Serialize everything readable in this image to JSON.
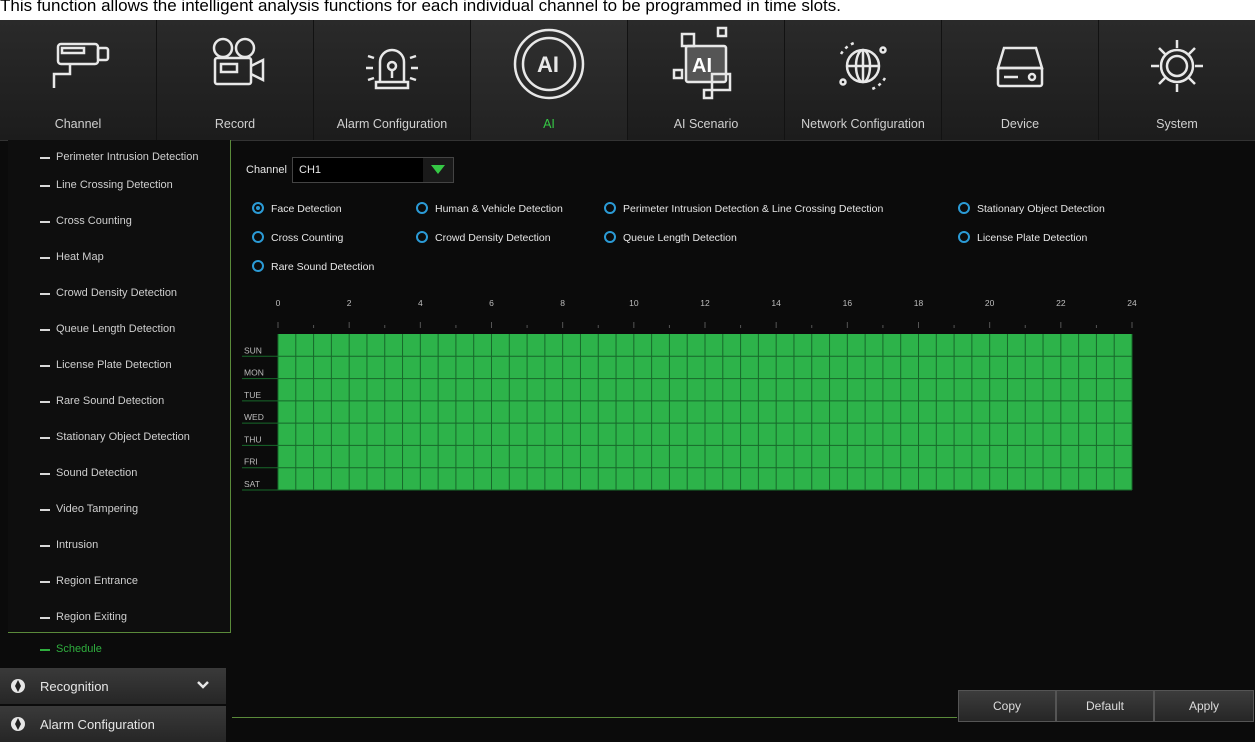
{
  "caption": "This function allows the intelligent analysis functions for each individual channel to be programmed in time slots.",
  "topnav": [
    {
      "label": "Channel",
      "icon": "camera-icon"
    },
    {
      "label": "Record",
      "icon": "video-camera-icon"
    },
    {
      "label": "Alarm Configuration",
      "icon": "alarm-siren-icon"
    },
    {
      "label": "AI",
      "icon": "ai-icon"
    },
    {
      "label": "AI Scenario",
      "icon": "ai-scenario-icon"
    },
    {
      "label": "Network Configuration",
      "icon": "globe-icon"
    },
    {
      "label": "Device",
      "icon": "hard-drive-icon"
    },
    {
      "label": "System",
      "icon": "gear-icon"
    }
  ],
  "active_tab": "AI",
  "sidebar": {
    "items": [
      "Perimeter Intrusion Detection",
      "Line Crossing Detection",
      "Cross Counting",
      "Heat Map",
      "Crowd Density Detection",
      "Queue Length Detection",
      "License Plate Detection",
      "Rare Sound Detection",
      "Stationary Object Detection",
      "Sound Detection",
      "Video Tampering",
      "Intrusion",
      "Region Entrance",
      "Region Exiting"
    ],
    "selected": "Schedule",
    "sections": [
      "Recognition",
      "Alarm Configuration"
    ]
  },
  "channel": {
    "label": "Channel",
    "value": "CH1"
  },
  "detections": [
    {
      "label": "Face Detection",
      "selected": true
    },
    {
      "label": "Human & Vehicle Detection",
      "selected": false
    },
    {
      "label": "Perimeter Intrusion Detection & Line Crossing Detection",
      "selected": false
    },
    {
      "label": "Stationary Object Detection",
      "selected": false
    },
    {
      "label": "Cross Counting",
      "selected": false
    },
    {
      "label": "Crowd Density Detection",
      "selected": false
    },
    {
      "label": "Queue Length Detection",
      "selected": false
    },
    {
      "label": "License Plate Detection",
      "selected": false
    },
    {
      "label": "Rare Sound Detection",
      "selected": false
    }
  ],
  "schedule": {
    "hours": [
      "0",
      "2",
      "4",
      "6",
      "8",
      "10",
      "12",
      "14",
      "16",
      "18",
      "20",
      "22",
      "24"
    ],
    "days": [
      "SUN",
      "MON",
      "TUE",
      "WED",
      "THU",
      "FRI",
      "SAT"
    ],
    "fill_color": "#2db34a",
    "all_scheduled": true
  },
  "buttons": {
    "copy": "Copy",
    "default": "Default",
    "apply": "Apply"
  },
  "colors": {
    "accent": "#35c845",
    "radio": "#2b9bd6",
    "grid_fill": "#2db34a"
  }
}
